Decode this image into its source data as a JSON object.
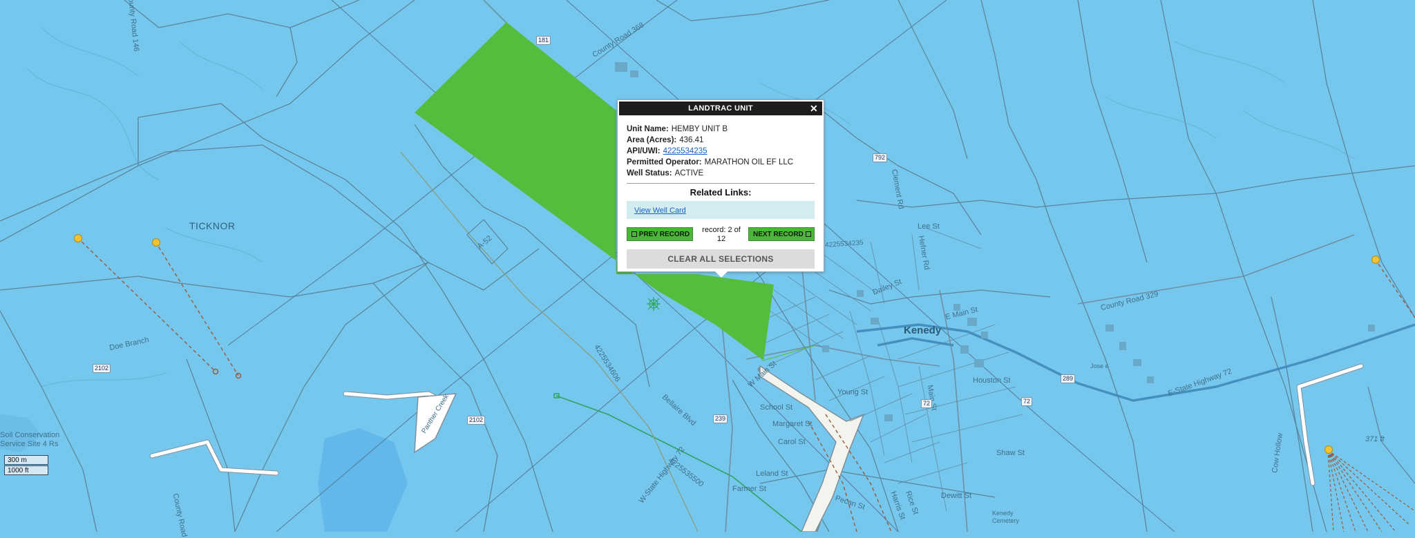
{
  "map": {
    "place_labels": [
      "TICKNOR",
      "Kenedy",
      "Doe Branch",
      "Soil Conservation\nService Site 4 Rs",
      "Kenedy\nCemetery",
      "Cow Hollow"
    ],
    "road_labels": [
      "County Road 368",
      "County Road 329",
      "E-State Highway 72",
      "W-State Highway 72",
      "County Road",
      "Panther Creek",
      "E Main St",
      "W Main St",
      "Houston St",
      "Lee St",
      "Dewitt St",
      "Shaw St",
      "Young St",
      "Margaret St",
      "Carol St",
      "Leland St",
      "Farmer St",
      "School St",
      "Dailey St",
      "Hefner Rd",
      "Clement Rd",
      "Bellaire Blvd",
      "Pecan St",
      "Main St",
      "Harris St",
      "Rice St",
      "County Road 146"
    ],
    "well_labels": [
      "4225534235",
      "4225534606",
      "4225535500",
      "A-52"
    ],
    "shields": [
      "181",
      "792",
      "2102",
      "239",
      "72",
      "289",
      "2102",
      "72"
    ],
    "elevation_label": "371 ft",
    "road_label_misc": "Jose e"
  },
  "scale_bar": {
    "metric": "300 m",
    "imperial": "1000 ft"
  },
  "popup": {
    "title": "LANDTRAC UNIT",
    "close_symbol": "✕",
    "fields": [
      {
        "label": "Unit Name:",
        "value": "HEMBY UNIT B"
      },
      {
        "label": "Area (Acres):",
        "value": "436.41"
      },
      {
        "label": "API/UWI:",
        "value": "4225534235",
        "link": true
      },
      {
        "label": "Permitted Operator:",
        "value": "MARATHON OIL EF LLC"
      },
      {
        "label": "Well Status:",
        "value": "ACTIVE"
      }
    ],
    "related_title": "Related Links:",
    "view_well_card": "View Well Card",
    "prev_label": "PREV RECORD",
    "next_label": "NEXT RECORD",
    "record_line1": "record: 2 of",
    "record_line2": "12",
    "clear_label": "CLEAR ALL SELECTIONS"
  },
  "colors": {
    "map_background": "#76c7ee",
    "selected_unit": "#55bd3a",
    "popup_header": "#1d1d1d",
    "nav_button": "#4eb53c",
    "related_links_bg": "#d3ecf0",
    "clear_button": "#dcdcdc"
  }
}
